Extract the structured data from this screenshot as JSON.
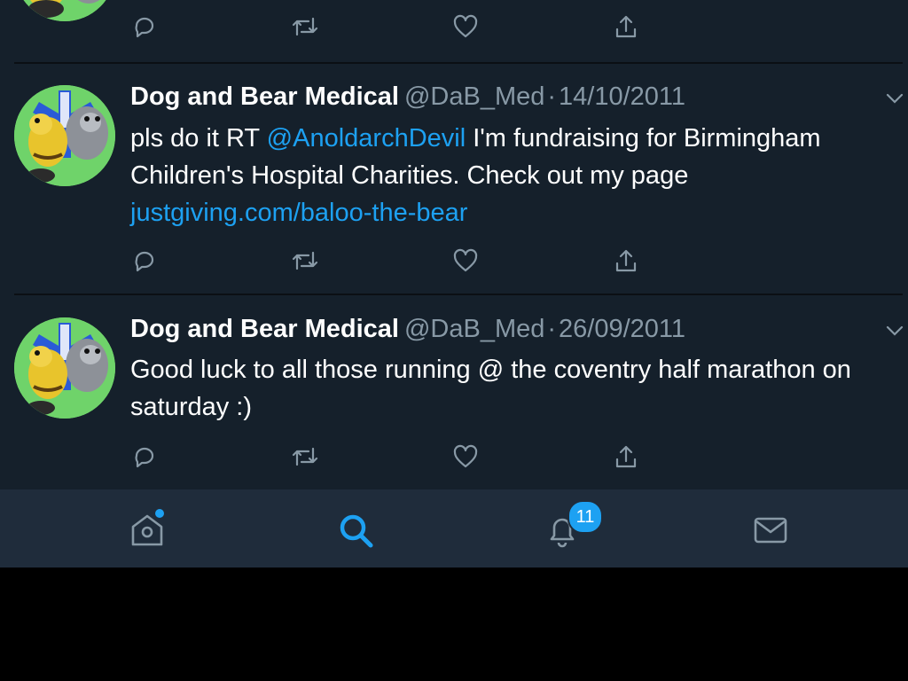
{
  "colors": {
    "background": "#15202b",
    "tab_bar": "#1f2c3b",
    "accent": "#1da1f2",
    "muted_text": "#8899a6",
    "primary_text": "#ffffff"
  },
  "tweets": [
    {
      "display_name": "Dog and Bear Medical",
      "handle": "@DaB_Med",
      "separator": "·",
      "date": "14/10/2011",
      "text_before": "pls do it RT ",
      "mention": "@AnoldarchDevil",
      "text_after": " I'm fundraising for Birmingham Children's Hospital Charities. Check out my page ",
      "link": "justgiving.com/baloo-the-bear"
    },
    {
      "display_name": "Dog and Bear Medical",
      "handle": "@DaB_Med",
      "separator": "·",
      "date": "26/09/2011",
      "text": "Good luck to all those running @ the coventry half marathon on saturday :)"
    }
  ],
  "icons": {
    "reply": "reply-icon",
    "retweet": "retweet-icon",
    "like": "like-icon",
    "share": "share-icon",
    "more": "chevron-down-icon"
  },
  "tab_bar": {
    "home": {
      "icon": "home-icon",
      "has_new_dot": true
    },
    "search": {
      "icon": "search-icon",
      "active": true
    },
    "notifications": {
      "icon": "bell-icon",
      "badge": "11"
    },
    "messages": {
      "icon": "envelope-icon"
    }
  }
}
